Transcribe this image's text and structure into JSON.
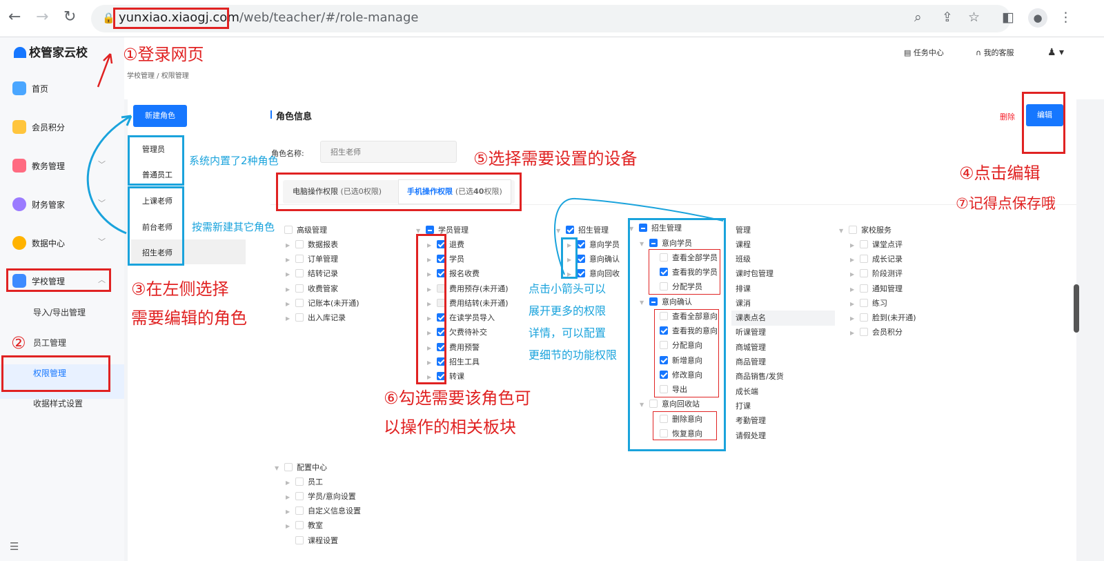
{
  "browser": {
    "url_host": "yunxiao.xiaogj.com",
    "url_path": "/web/teacher/#/role-manage"
  },
  "sidebar": {
    "brand": "校管家云校",
    "items": [
      {
        "label": "首页"
      },
      {
        "label": "会员积分"
      },
      {
        "label": "教务管理"
      },
      {
        "label": "财务管家"
      },
      {
        "label": "数据中心"
      },
      {
        "label": "学校管理"
      }
    ],
    "sub_items": [
      {
        "label": "导入/导出管理"
      },
      {
        "label": "员工管理"
      },
      {
        "label": "权限管理"
      },
      {
        "label": "收据样式设置"
      }
    ]
  },
  "header": {
    "breadcrumb": "学校管理 / 权限管理",
    "task_center": "任务中心",
    "service": "我的客服"
  },
  "roles": {
    "new_button": "新建角色",
    "builtin": [
      "管理员",
      "普通员工"
    ],
    "custom": [
      "上课老师",
      "前台老师",
      "招生老师"
    ]
  },
  "detail": {
    "title": "角色信息",
    "delete": "删除",
    "edit": "编辑",
    "name_label": "角色名称:",
    "name_placeholder": "招生老师",
    "tab_pc": "电脑操作权限",
    "tab_pc_count": "(已选0权限)",
    "tab_mobile": "手机操作权限",
    "tab_mobile_count_pre": "(已选",
    "tab_mobile_count_num": "40",
    "tab_mobile_count_post": "权限)"
  },
  "tree": {
    "col1": {
      "title": "高级管理",
      "items": [
        "数据报表",
        "订单管理",
        "结转记录",
        "收费管家",
        "记账本(未开通)",
        "出入库记录"
      ]
    },
    "col2": {
      "title": "学员管理",
      "items": [
        "退费",
        "学员",
        "报名收费",
        "费用预存(未开通)",
        "费用结转(未开通)",
        "在读学员导入",
        "欠费待补交",
        "费用预警",
        "招生工具",
        "转课"
      ]
    },
    "col3": {
      "title": "招生管理",
      "items": [
        "意向学员",
        "意向确认",
        "意向回收"
      ]
    },
    "col4": {
      "title": "招生管理",
      "g1": "意向学员",
      "g1_items": [
        "查看全部学员",
        "查看我的学员",
        "分配学员"
      ],
      "g2": "意向确认",
      "g2_items": [
        "查看全部意向",
        "查看我的意向",
        "分配意向",
        "新增意向",
        "修改意向",
        "导出"
      ],
      "g3": "意向回收站",
      "g3_items": [
        "删除意向",
        "恢复意向"
      ]
    },
    "col5": [
      "管理",
      "课程",
      "班级",
      "课时包管理",
      "排课",
      "课消",
      "课表点名",
      "听课管理",
      "商城管理",
      "商品管理",
      "商品销售/发货",
      "成长端",
      "打课",
      "考勤管理",
      "请假处理"
    ],
    "col6": {
      "title": "家校服务",
      "items": [
        "课堂点评",
        "成长记录",
        "阶段测评",
        "通知管理",
        "练习",
        "脸到(未开通)",
        "会员积分"
      ]
    },
    "col7": {
      "title": "配置中心",
      "items": [
        "员工",
        "学员/意向设置",
        "自定义信息设置",
        "教室",
        "课程设置"
      ]
    }
  },
  "annotations": {
    "a1": "①登录网页",
    "a2": "②",
    "a3_line1": "③在左侧选择",
    "a3_line2": "需要编辑的角色",
    "a4": "④点击编辑",
    "a5": "⑤选择需要设置的设备",
    "a6_line1": "⑥勾选需要该角色可",
    "a6_line2": "以操作的相关板块",
    "a7": "⑦记得点保存哦",
    "builtin_note": "系统内置了2种角色",
    "custom_note": "按需新建其它角色",
    "arrow_note": [
      "点击小箭头可以",
      "展开更多的权限",
      "详情，可以配置",
      "更细节的功能权限"
    ]
  },
  "colors": {
    "primary": "#1677ff",
    "annotation_red": "#e02222",
    "annotation_blue": "#1aa3dc"
  }
}
